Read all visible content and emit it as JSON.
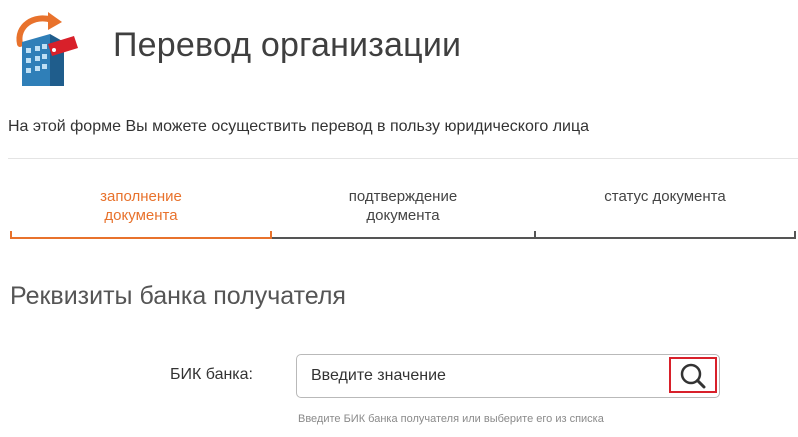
{
  "header": {
    "title": "Перевод организации",
    "logo_icon": "building-transfer-icon"
  },
  "intro_text": "На этой форме Вы можете осуществить перевод в пользу юридического лица",
  "steps": [
    {
      "label": "заполнение\nдокумента",
      "active": true
    },
    {
      "label": "подтверждение\nдокумента",
      "active": false
    },
    {
      "label": "статус документа",
      "active": false
    }
  ],
  "section": {
    "title": "Реквизиты банка получателя"
  },
  "bik_field": {
    "label": "БИК банка:",
    "value": "Введите значение",
    "hint": "Введите БИК банка получателя или выберите его из списка",
    "button_icon": "search-icon"
  },
  "colors": {
    "accent": "#e8722c",
    "highlight_border": "#d8202a",
    "text": "#333333"
  }
}
